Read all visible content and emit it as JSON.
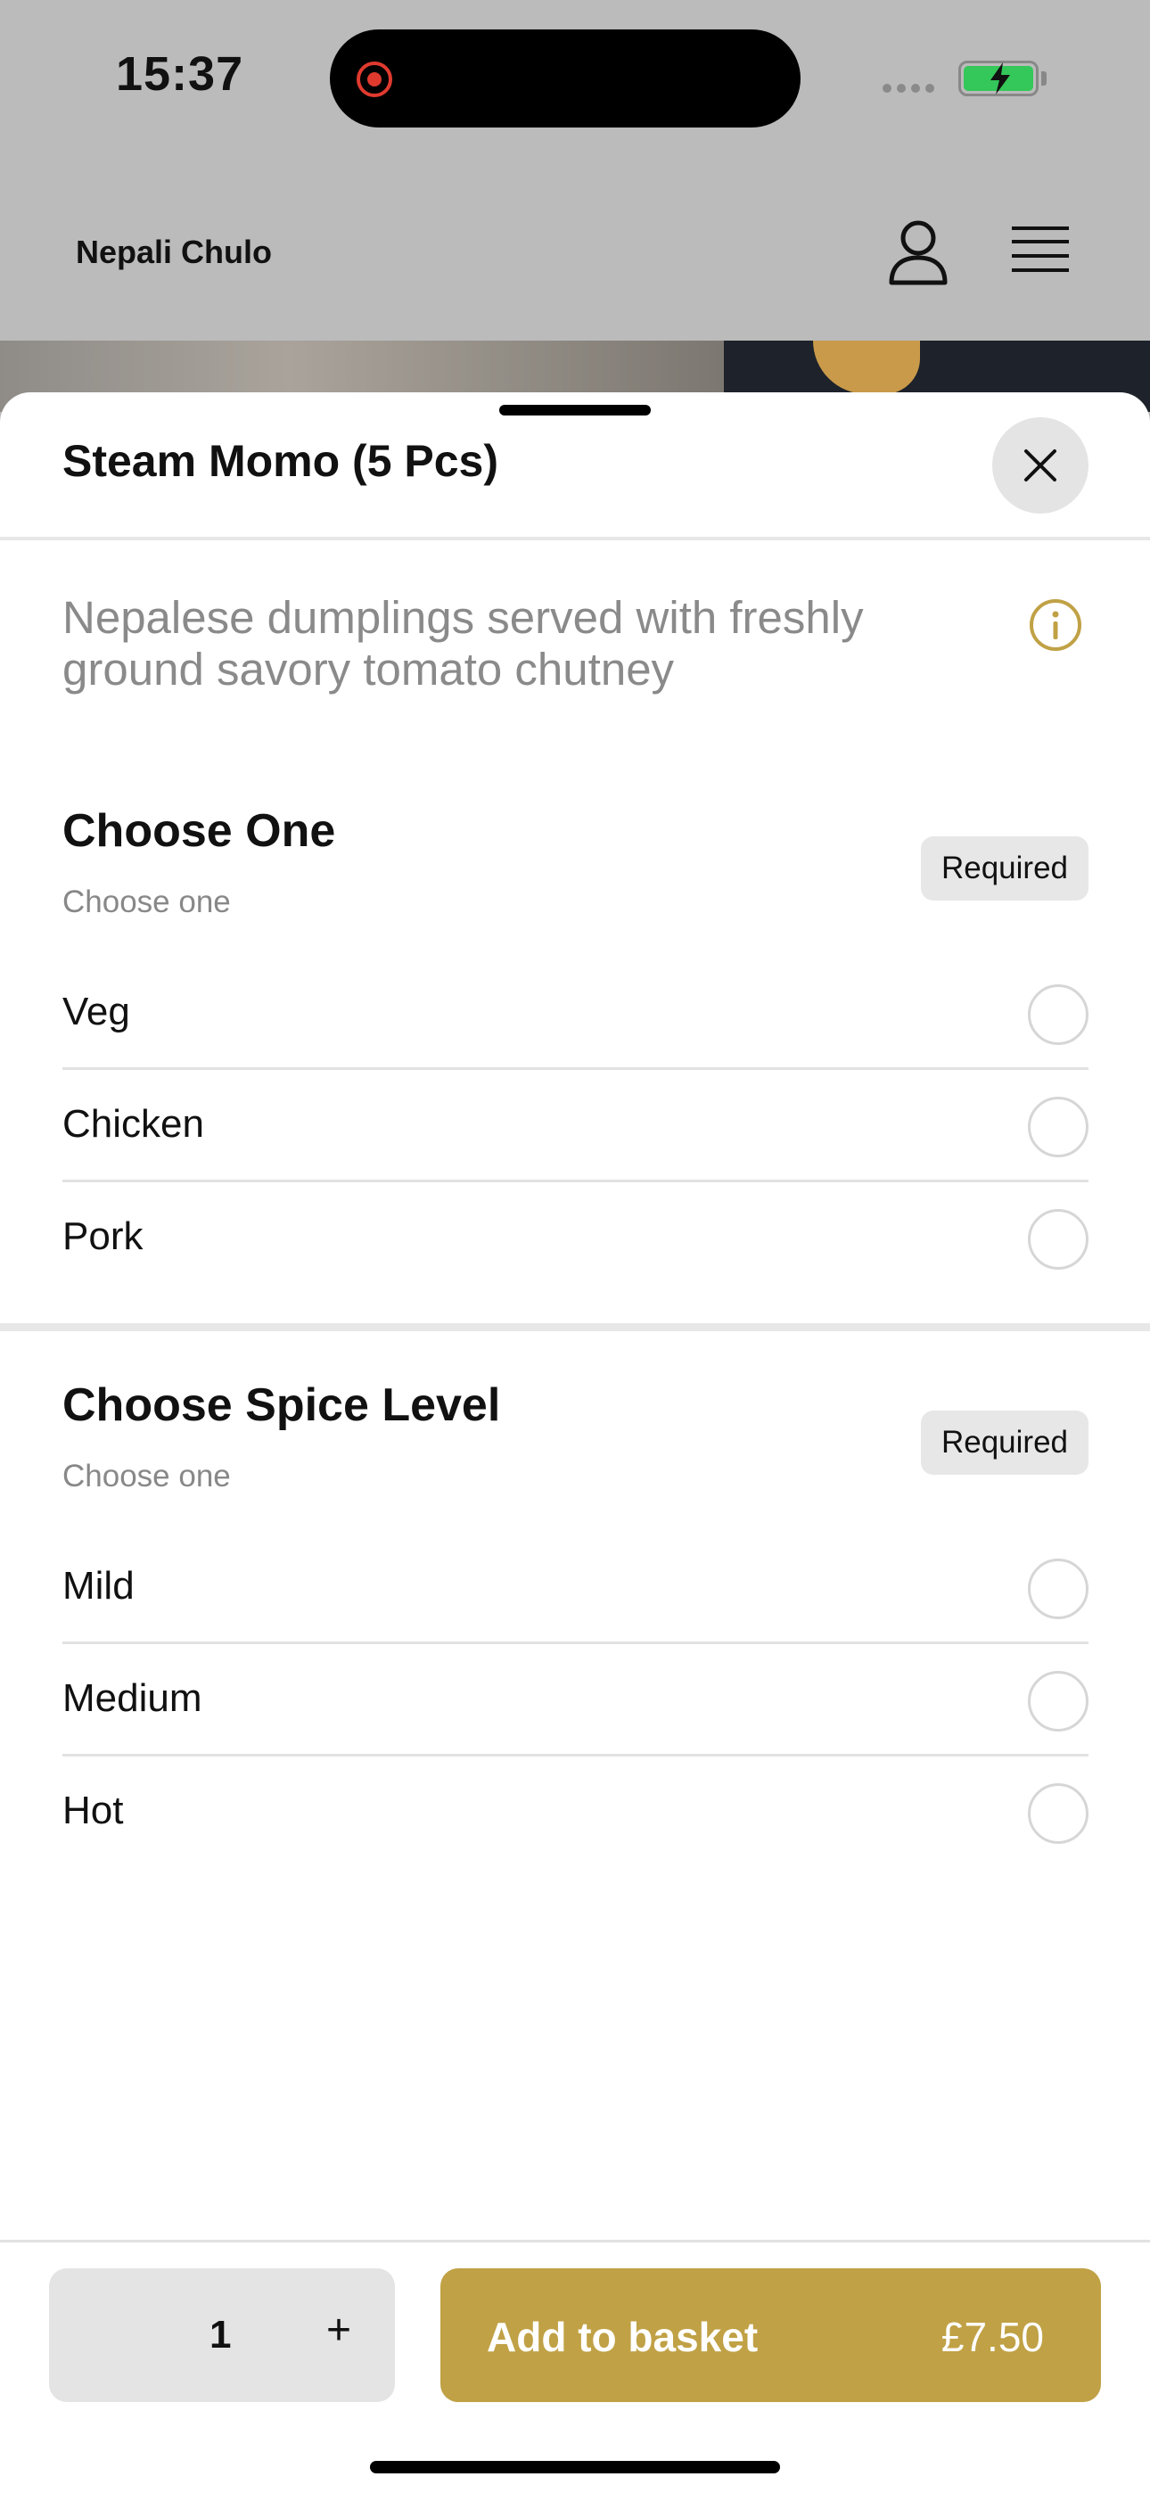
{
  "status_bar": {
    "time": "15:37"
  },
  "header": {
    "brand": "Nepali Chulo",
    "user_icon": "user-icon",
    "menu_icon": "hamburger-menu-icon"
  },
  "item": {
    "title": "Steam Momo (5 Pcs)",
    "description": "Nepalese dumplings served with freshly ground savory tomato chutney",
    "info_icon": "info-icon"
  },
  "sections": [
    {
      "title": "Choose One",
      "subtitle": "Choose one",
      "badge": "Required",
      "options": [
        {
          "label": "Veg",
          "selected": false
        },
        {
          "label": "Chicken",
          "selected": false
        },
        {
          "label": "Pork",
          "selected": false
        }
      ]
    },
    {
      "title": "Choose Spice Level",
      "subtitle": "Choose one",
      "badge": "Required",
      "options": [
        {
          "label": "Mild",
          "selected": false
        },
        {
          "label": "Medium",
          "selected": false
        },
        {
          "label": "Hot",
          "selected": false
        }
      ]
    }
  ],
  "footer": {
    "quantity": "1",
    "plus_label": "+",
    "add_label": "Add to basket",
    "price": "£7.50"
  },
  "colors": {
    "accent": "#c0a145",
    "badge_bg": "#e7e7e7",
    "overlay": "#bbbbbb"
  }
}
